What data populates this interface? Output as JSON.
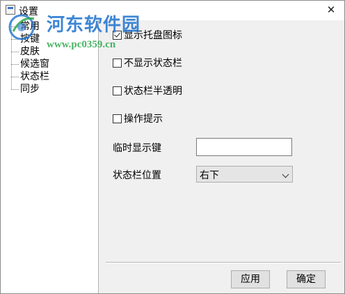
{
  "window": {
    "title": "设置",
    "close_icon": "close-icon"
  },
  "watermark": {
    "site_name": "河东软件园",
    "url": "www.pc0359.cn"
  },
  "sidebar": {
    "items": [
      {
        "label": "常用"
      },
      {
        "label": "按键"
      },
      {
        "label": "皮肤"
      },
      {
        "label": "候选窗"
      },
      {
        "label": "状态栏"
      },
      {
        "label": "同步"
      }
    ]
  },
  "settings": {
    "show_tray_icon": {
      "label": "显示托盘图标",
      "checked": true
    },
    "hide_status_bar": {
      "label": "不显示状态栏",
      "checked": false
    },
    "status_bar_translucent": {
      "label": "状态栏半透明",
      "checked": false
    },
    "operation_tips": {
      "label": "操作提示",
      "checked": false
    },
    "temp_show_key": {
      "label": "临时显示键",
      "value": ""
    },
    "status_bar_position": {
      "label": "状态栏位置",
      "value": "右下"
    }
  },
  "buttons": {
    "apply": "应用",
    "ok": "确定"
  },
  "colors": {
    "window_bg": "#f0f0f0",
    "sidebar_bg": "#ffffff",
    "watermark_blue": "#2a79d0",
    "watermark_green": "#2aa84a"
  }
}
